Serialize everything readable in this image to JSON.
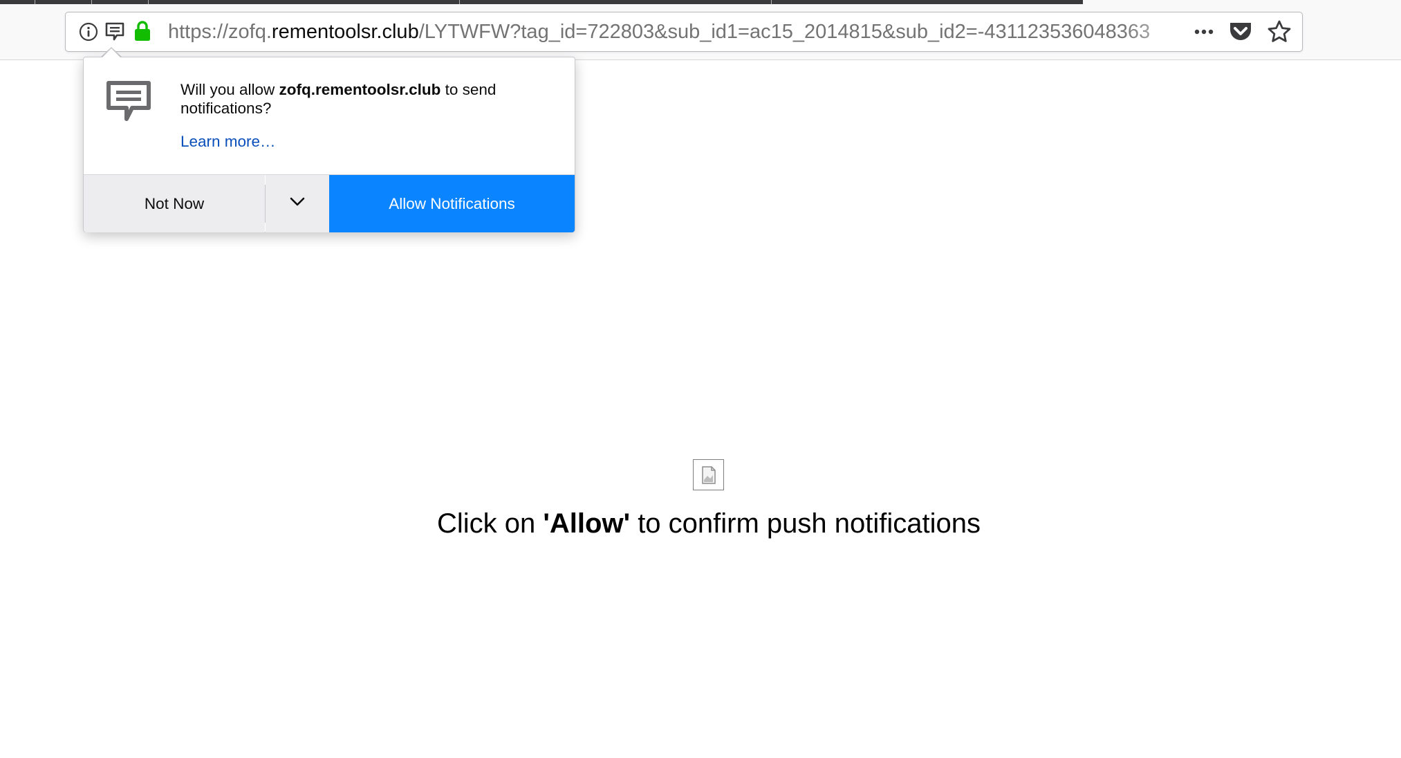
{
  "browser": {
    "url_scheme": "https://zofq.",
    "url_host": "rementoolsr.club",
    "url_path": "/LYTWFW?tag_id=722803&sub_id1=ac15_2014815&sub_id2=-431123536048363",
    "icons": {
      "info": "info-icon",
      "permission": "notification-permission-icon",
      "lock": "lock-icon",
      "more": "more-icon",
      "pocket": "pocket-icon",
      "bookmark": "star-icon"
    },
    "colors": {
      "lock": "#12bc00",
      "accent": "#0a84ff"
    }
  },
  "popup": {
    "message_prefix": "Will you allow ",
    "site": "zofq.rementoolsr.club",
    "message_suffix": " to send notifications?",
    "learn_more": "Learn more…",
    "not_now": "Not Now",
    "allow": "Allow Notifications",
    "icon": "notification-chat-icon"
  },
  "page": {
    "cta_prefix": "Click on ",
    "cta_bold": "'Allow'",
    "cta_suffix": " to confirm push notifications",
    "image_icon": "broken-image-icon"
  }
}
